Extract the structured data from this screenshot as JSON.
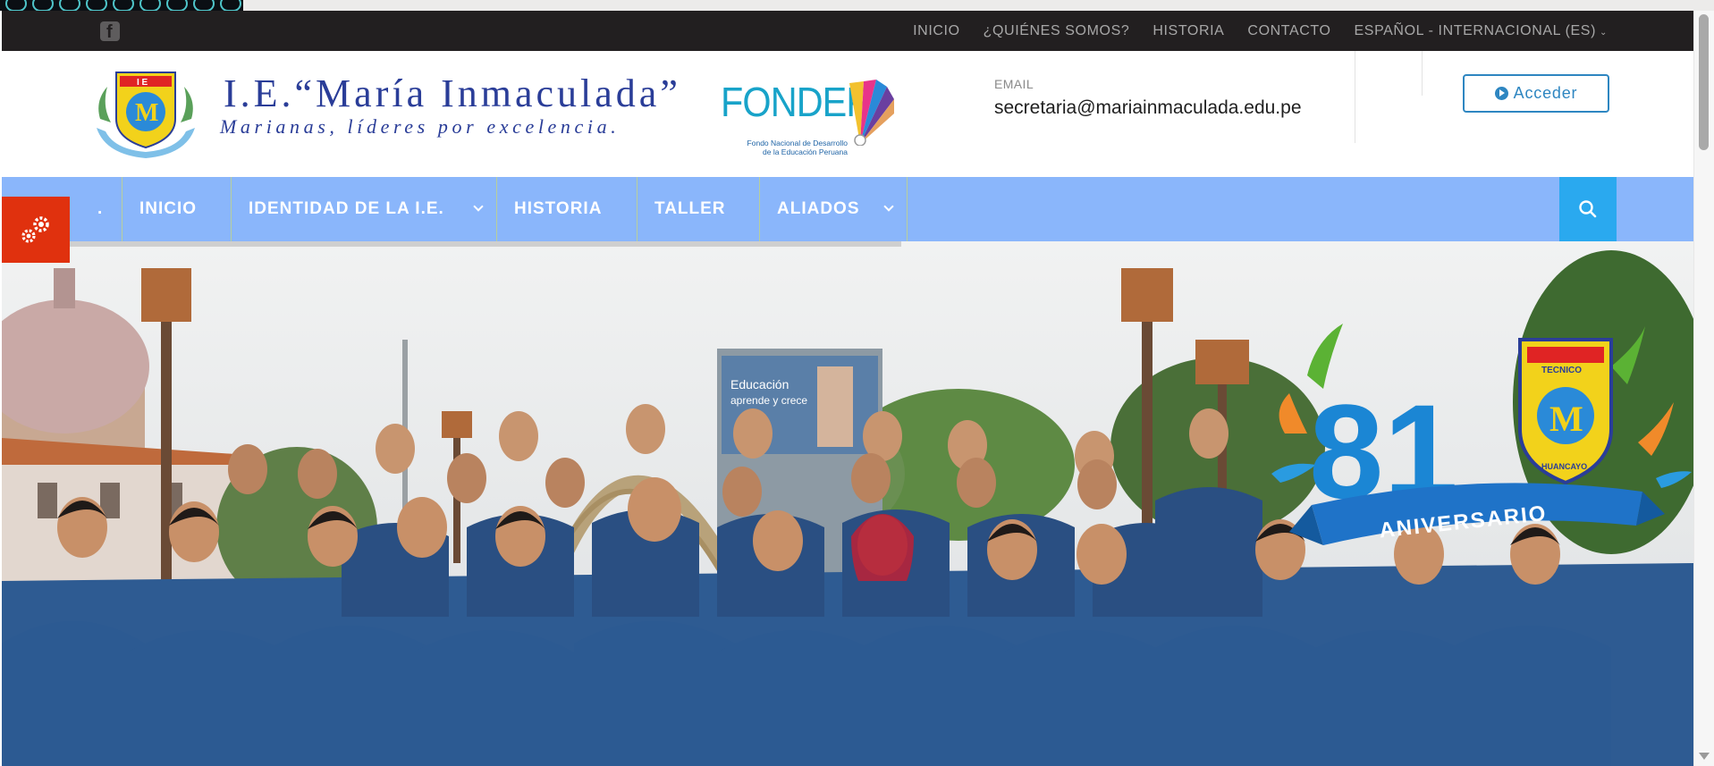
{
  "topbar": {
    "social_icon": "facebook-icon",
    "links": [
      {
        "label": "INICIO"
      },
      {
        "label": "¿QUIÉNES SOMOS?"
      },
      {
        "label": "HISTORIA"
      },
      {
        "label": "CONTACTO"
      }
    ],
    "language": "ESPAÑOL - INTERNACIONAL (ES)"
  },
  "header": {
    "school_name": "I.E.“María Inmaculada”",
    "tagline": "Marianas, líderes por excelencia.",
    "partner_logo": "FONDEP",
    "partner_subtitle_1": "Fondo Nacional de Desarrollo",
    "partner_subtitle_2": "de la Educación Peruana",
    "crest_letters": "I E",
    "email_label": "EMAIL",
    "email": "secretaria@mariainmaculada.edu.pe",
    "login_label": "Acceder",
    "brand_color": "#2a3d98",
    "accent_color": "#2e86c1"
  },
  "nav": {
    "items": [
      {
        "label": "."
      },
      {
        "label": "INICIO"
      },
      {
        "label": "IDENTIDAD DE LA I.E."
      },
      {
        "label": "HISTORIA"
      },
      {
        "label": "TALLER"
      },
      {
        "label": "ALIADOS"
      }
    ],
    "bg_color": "#8ab6fb",
    "search_icon": "search-icon",
    "search_bg": "#2aa9ef"
  },
  "hero": {
    "badge_number": "81",
    "badge_text": "ANIVERSARIO",
    "badge_crest_top": "TECNICO",
    "badge_crest_bottom": "HUANCAYO",
    "billboard_text_1": "Educación",
    "billboard_text_2": "aprende y crece"
  },
  "settings": {
    "icon": "gears-icon",
    "bg_color": "#e0310e"
  }
}
